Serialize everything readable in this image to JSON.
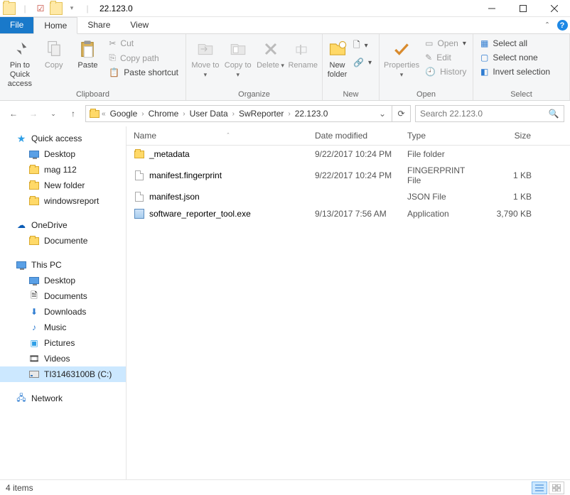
{
  "window": {
    "title": "22.123.0"
  },
  "tabs": {
    "file": "File",
    "home": "Home",
    "share": "Share",
    "view": "View"
  },
  "ribbon": {
    "clipboard": {
      "label": "Clipboard",
      "pin": "Pin to Quick access",
      "copy": "Copy",
      "paste": "Paste",
      "cut": "Cut",
      "copypath": "Copy path",
      "pasteshortcut": "Paste shortcut"
    },
    "organize": {
      "label": "Organize",
      "moveto": "Move to",
      "copyto": "Copy to",
      "delete": "Delete",
      "rename": "Rename"
    },
    "new": {
      "label": "New",
      "newfolder": "New folder"
    },
    "open": {
      "label": "Open",
      "properties": "Properties",
      "open": "Open",
      "edit": "Edit",
      "history": "History"
    },
    "select": {
      "label": "Select",
      "selectall": "Select all",
      "selectnone": "Select none",
      "invert": "Invert selection"
    }
  },
  "breadcrumbs": [
    "Google",
    "Chrome",
    "User Data",
    "SwReporter",
    "22.123.0"
  ],
  "search": {
    "placeholder": "Search 22.123.0"
  },
  "columns": {
    "name": "Name",
    "date": "Date modified",
    "type": "Type",
    "size": "Size"
  },
  "files": [
    {
      "icon": "folder",
      "name": "_metadata",
      "date": "9/22/2017 10:24 PM",
      "type": "File folder",
      "size": ""
    },
    {
      "icon": "file",
      "name": "manifest.fingerprint",
      "date": "9/22/2017 10:24 PM",
      "type": "FINGERPRINT File",
      "size": "1 KB"
    },
    {
      "icon": "file",
      "name": "manifest.json",
      "date": "",
      "type": "JSON File",
      "size": "1 KB"
    },
    {
      "icon": "exe",
      "name": "software_reporter_tool.exe",
      "date": "9/13/2017 7:56 AM",
      "type": "Application",
      "size": "3,790 KB"
    }
  ],
  "nav": {
    "quickaccess": "Quick access",
    "qa_items": [
      "Desktop",
      "mag 112",
      "New folder",
      "windowsreport"
    ],
    "onedrive": "OneDrive",
    "od_items": [
      "Documente"
    ],
    "thispc": "This PC",
    "pc_items": [
      "Desktop",
      "Documents",
      "Downloads",
      "Music",
      "Pictures",
      "Videos",
      "TI31463100B (C:)"
    ],
    "network": "Network"
  },
  "status": {
    "count": "4 items"
  }
}
